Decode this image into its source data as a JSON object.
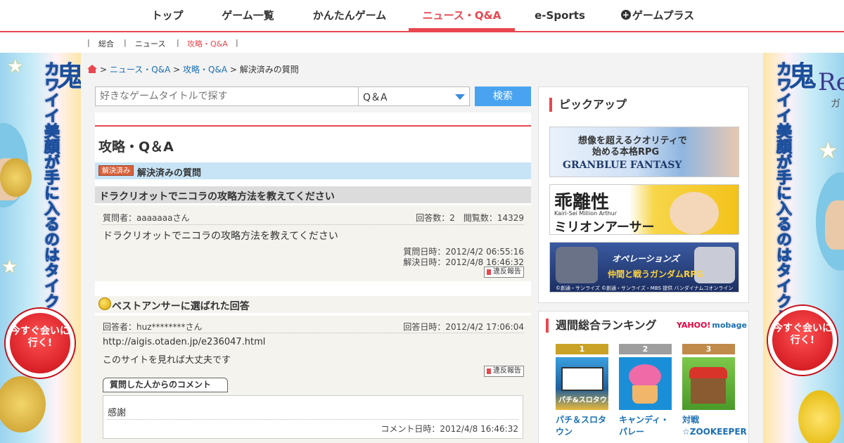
{
  "topnav": {
    "items": [
      {
        "label": "トップ"
      },
      {
        "label": "ゲーム一覧"
      },
      {
        "label": "かんたんゲーム"
      },
      {
        "label": "ニュース・Q&A"
      },
      {
        "label": "e-Sports"
      },
      {
        "label": "ゲームプラス"
      }
    ],
    "active_color": "#e8474f"
  },
  "subnav": {
    "separator": "|",
    "items": [
      {
        "label": "総合"
      },
      {
        "label": "ニュース"
      },
      {
        "label": "攻略・Q&A"
      }
    ]
  },
  "left_ad": {
    "headline_big": "鬼",
    "headline": "カワイイ美顔が手に入るのはタイクレだけ!",
    "cta": "今すぐ会いに行く!"
  },
  "right_ad": {
    "brand": "Re",
    "brand_sub": "ガ",
    "headline_big": "鬼",
    "headline": "カワイイ美顔が手に入るのはタイクレだけ!",
    "cta": "今すぐ会いに行く!"
  },
  "breadcrumb": {
    "sep": ">",
    "items": [
      "ニュース・Q&A",
      "攻略・Q&A"
    ],
    "current": "解決済みの質問"
  },
  "search": {
    "placeholder": "好きなゲームタイトルで探す",
    "category": "Q＆A",
    "button": "検索"
  },
  "page": {
    "title": "攻略・Q＆A",
    "solved_badge": "解決済み",
    "solved_label": "解決済みの質問"
  },
  "question": {
    "title": "ドラクリオットでニコラの攻略方法を教えてください",
    "asker": "質問者：aaaaaaaさん",
    "stats": "回答数：2　閲覧数：14329",
    "body": "ドラクリオットでニコラの攻略方法を教えてください",
    "asked_at": "質問日時：2012/4/2 06:55:16",
    "solved_at": "解決日時：2012/4/8 16:46:32",
    "report": "違反報告"
  },
  "best_answer": {
    "heading": "ベストアンサーに選ばれた回答",
    "answerer": "回答者：huz********さん",
    "answered_at": "回答日時：2012/4/2 17:06:04",
    "url": "http://aigis.otaden.jp/e236047.html",
    "body": "このサイトを見れば大丈夫です",
    "report": "違反報告",
    "comment_heading": "質問した人からのコメント",
    "comment": "感謝",
    "comment_at": "コメント日時：2012/4/8 16:46:32"
  },
  "pickup": {
    "title": "ピックアップ",
    "banners": [
      {
        "line1": "想像を超えるクオリティで",
        "line2": "始める本格RPG",
        "logo": "GRANBLUE FANTASY"
      },
      {
        "line1": "乖離性",
        "line2": "ミリオンアーサー",
        "small": "Kairi-Sei Million Arthur"
      },
      {
        "line1": "オペレーションズ",
        "line2": "仲間と戦うガンダムRPG",
        "small": "©創通・サンライズ ©創通・サンライズ・MBS 提供 バンダイナムコオンライン"
      }
    ]
  },
  "ranking": {
    "title": "週間総合ランキング",
    "brand_yahoo": "YAHOO!",
    "brand_mobage": "mobage",
    "items": [
      {
        "rank": "1",
        "name": "パチ＆スロタウン",
        "color": "#c9a227",
        "img_text": "パチ&スロタウン"
      },
      {
        "rank": "2",
        "name": "キャンディ・パレー",
        "color": "#9e9e9e",
        "img_text": ""
      },
      {
        "rank": "3",
        "name": "対戦☆ZOOKEEPER",
        "color": "#c08a4a",
        "img_text": ""
      }
    ]
  }
}
